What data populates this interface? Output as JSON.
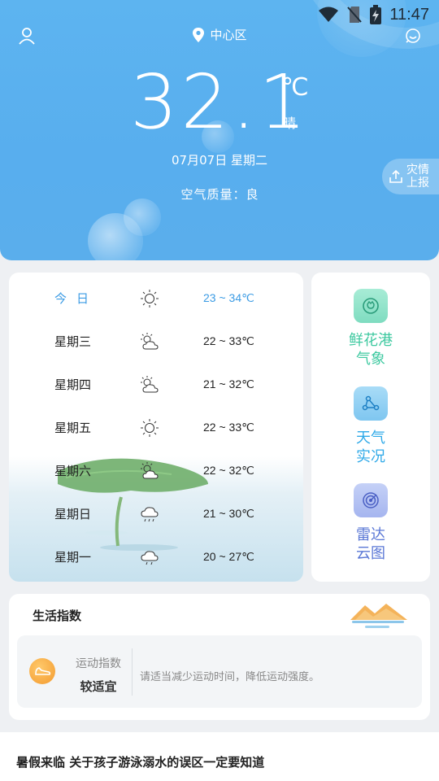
{
  "status_bar": {
    "time": "11:47",
    "icons": [
      "wifi-icon",
      "no-sim-icon",
      "battery-charging-icon"
    ]
  },
  "header": {
    "location": "中心区",
    "temperature": "32.1",
    "unit": "℃",
    "condition": "晴",
    "date": "07月07日 星期二",
    "air_quality_label": "空气质量：",
    "air_quality_value": "良",
    "report_button": {
      "line1": "灾情",
      "line2": "上报"
    }
  },
  "forecast": [
    {
      "day": "今日",
      "icon": "sun-icon",
      "low": 23,
      "high": 34,
      "range": "23 ~ 34℃",
      "today": true
    },
    {
      "day": "星期三",
      "icon": "partly-cloudy-icon",
      "low": 22,
      "high": 33,
      "range": "22 ~ 33℃"
    },
    {
      "day": "星期四",
      "icon": "partly-cloudy-icon",
      "low": 21,
      "high": 32,
      "range": "21 ~ 32℃"
    },
    {
      "day": "星期五",
      "icon": "sun-icon",
      "low": 22,
      "high": 33,
      "range": "22 ~ 33℃"
    },
    {
      "day": "星期六",
      "icon": "partly-cloudy-icon",
      "low": 22,
      "high": 32,
      "range": "22 ~ 32℃"
    },
    {
      "day": "星期日",
      "icon": "rain-icon",
      "low": 21,
      "high": 30,
      "range": "21 ~ 30℃"
    },
    {
      "day": "星期一",
      "icon": "cloudy-rain-icon",
      "low": 20,
      "high": 27,
      "range": "20 ~ 27℃"
    }
  ],
  "side_links": [
    {
      "line1": "鲜花港",
      "line2": "气象",
      "icon": "flower-icon",
      "color": "#3ec9a0"
    },
    {
      "line1": "天气",
      "line2": "实况",
      "icon": "network-icon",
      "color": "#2fa9e8"
    },
    {
      "line1": "雷达",
      "line2": "云图",
      "icon": "radar-icon",
      "color": "#5b78d6"
    }
  ],
  "life_index": {
    "title": "生活指数",
    "item_name": "运动指数",
    "item_level": "较适宜",
    "item_tip": "请适当减少运动时间，降低运动强度。"
  },
  "news": {
    "title": "暑假来临 关于孩子游泳溺水的误区一定要知道"
  },
  "colors": {
    "header_blue": "#5aaeec",
    "today_blue": "#3b9be4"
  }
}
